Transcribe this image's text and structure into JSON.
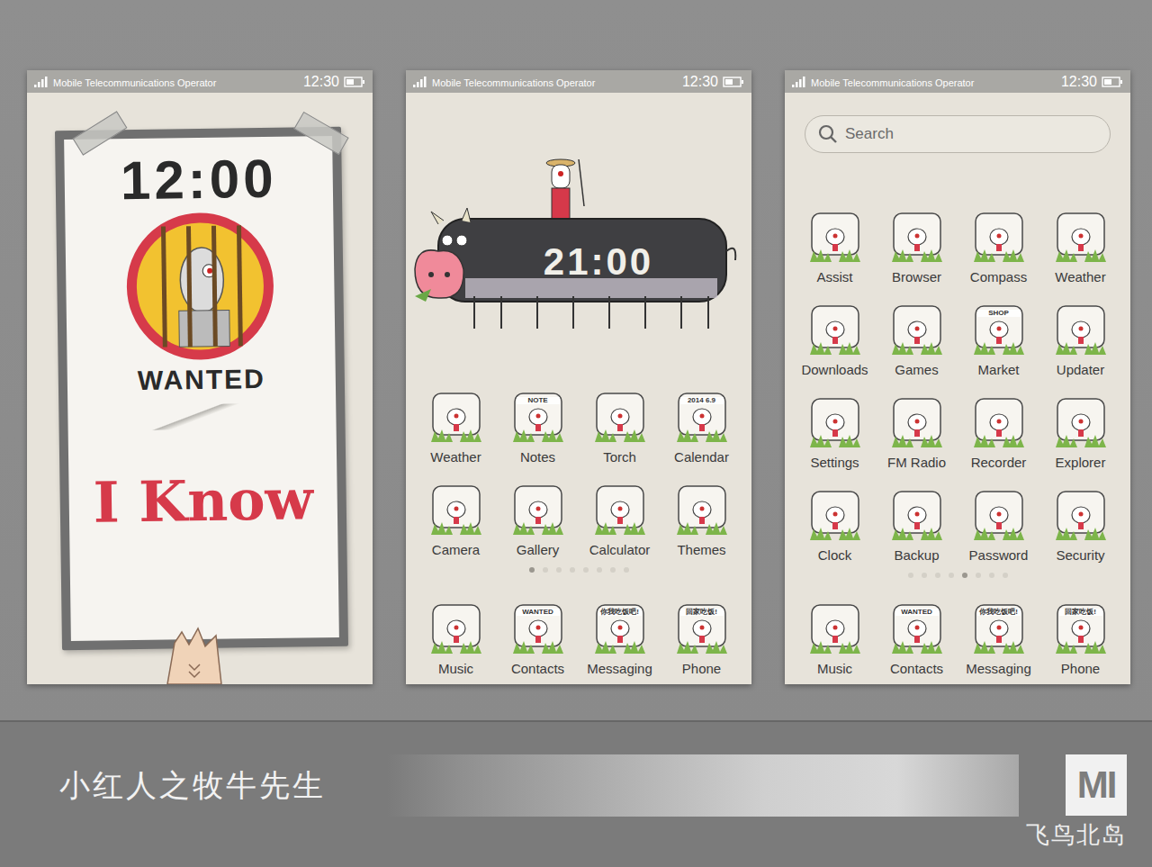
{
  "status_bar": {
    "carrier": "Mobile Telecommunications Operator",
    "time": "12:30"
  },
  "lock_screen": {
    "time": "12:00",
    "poster_label": "WANTED",
    "headline": "I Know"
  },
  "home_screen": {
    "clock": "21:00",
    "apps": [
      {
        "label": "Weather"
      },
      {
        "label": "Notes",
        "badge": "NOTE"
      },
      {
        "label": "Torch"
      },
      {
        "label": "Calendar",
        "badge": "2014 6.9"
      },
      {
        "label": "Camera"
      },
      {
        "label": "Gallery"
      },
      {
        "label": "Calculator"
      },
      {
        "label": "Themes"
      }
    ],
    "pages": [
      {
        "selected": true
      },
      {
        "selected": false
      },
      {
        "selected": false
      },
      {
        "selected": false
      },
      {
        "selected": false
      },
      {
        "selected": false
      },
      {
        "selected": false
      },
      {
        "selected": false
      }
    ]
  },
  "app_drawer": {
    "search": {
      "placeholder": "Search"
    },
    "apps": [
      {
        "label": "Assist"
      },
      {
        "label": "Browser"
      },
      {
        "label": "Compass"
      },
      {
        "label": "Weather"
      },
      {
        "label": "Downloads"
      },
      {
        "label": "Games"
      },
      {
        "label": "Market",
        "badge": "SHOP"
      },
      {
        "label": "Updater"
      },
      {
        "label": "Settings"
      },
      {
        "label": "FM Radio"
      },
      {
        "label": "Recorder"
      },
      {
        "label": "Explorer"
      },
      {
        "label": "Clock"
      },
      {
        "label": "Backup"
      },
      {
        "label": "Password"
      },
      {
        "label": "Security"
      }
    ],
    "pages": [
      {
        "selected": false
      },
      {
        "selected": false
      },
      {
        "selected": false
      },
      {
        "selected": false
      },
      {
        "selected": true
      },
      {
        "selected": false
      },
      {
        "selected": false
      },
      {
        "selected": false
      }
    ]
  },
  "dock": [
    {
      "label": "Music"
    },
    {
      "label": "Contacts",
      "badge": "WANTED"
    },
    {
      "label": "Messaging",
      "badge": "你我吃饭吧!"
    },
    {
      "label": "Phone",
      "badge": "回家吃饭!"
    }
  ],
  "footer": {
    "title": "小红人之牧牛先生",
    "logo": "MI",
    "signature": "飞鸟北岛"
  }
}
